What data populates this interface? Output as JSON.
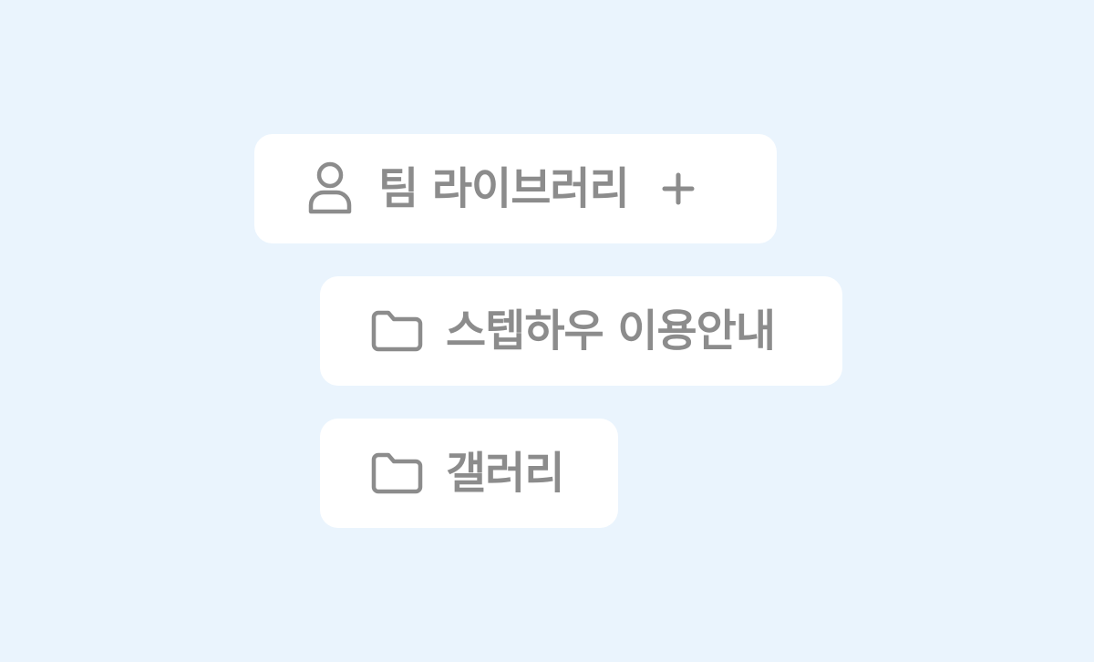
{
  "team_library": {
    "label": "팀 라이브러리",
    "icon": "user-icon",
    "add_icon": "plus-icon"
  },
  "folders": [
    {
      "label": "스텝하우 이용안내",
      "icon": "folder-icon"
    },
    {
      "label": "갤러리",
      "icon": "folder-icon"
    }
  ],
  "colors": {
    "background": "#EAF4FD",
    "card": "#FFFFFF",
    "text": "#8C8C8C"
  }
}
